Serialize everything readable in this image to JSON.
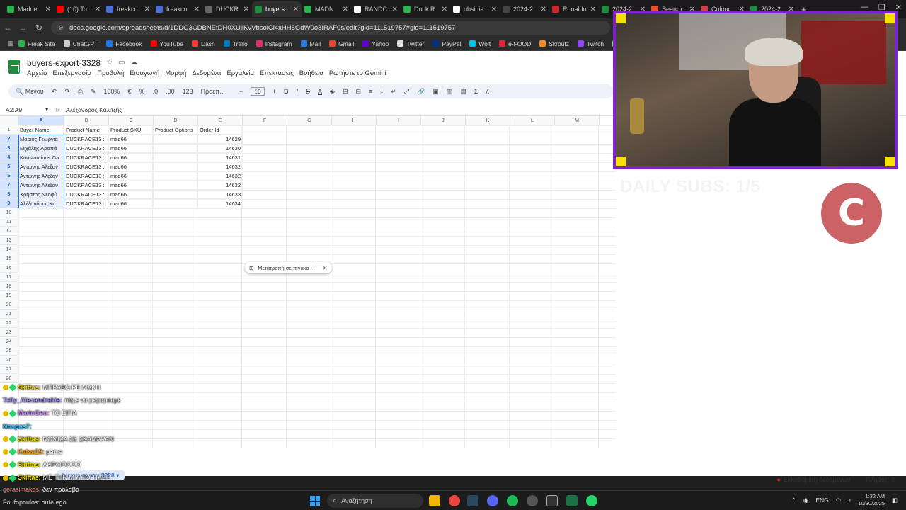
{
  "browser": {
    "tabs": [
      {
        "label": "Madne",
        "color": "#2bb24c"
      },
      {
        "label": "(10) Το",
        "color": "#ff0000"
      },
      {
        "label": "freakco",
        "color": "#4a6fd6"
      },
      {
        "label": "freakco",
        "color": "#4a6fd6"
      },
      {
        "label": "DUCKR",
        "color": "#666666"
      },
      {
        "label": "buyers",
        "color": "#1e8e3e"
      },
      {
        "label": "MADN",
        "color": "#2bb24c"
      },
      {
        "label": "RANDC",
        "color": "#ffffff"
      },
      {
        "label": "Duck R",
        "color": "#2bb24c"
      },
      {
        "label": "obsidia",
        "color": "#ffffff"
      },
      {
        "label": "2024-2",
        "color": "#444444"
      },
      {
        "label": "Ronaldo",
        "color": "#cc2a2a"
      },
      {
        "label": "2024-2",
        "color": "#1e8e3e"
      },
      {
        "label": "Search",
        "color": "#f25022"
      },
      {
        "label": "Colour",
        "color": "#c44"
      },
      {
        "label": "2024-2",
        "color": "#1e8e3e"
      }
    ],
    "url": "docs.google.com/spreadsheets/d/1DDG3CDBNEtDH0XUjlKvVbsolCi4xHH5GdW0o8IRAF0s/edit?gid=111519757#gid=111519757",
    "bookmarks": [
      {
        "label": "Freak Site",
        "color": "#2bb24c"
      },
      {
        "label": "ChatGPT",
        "color": "#cccccc"
      },
      {
        "label": "Facebook",
        "color": "#1877f2"
      },
      {
        "label": "YouTube",
        "color": "#ff0000"
      },
      {
        "label": "Dash",
        "color": "#ff3b30"
      },
      {
        "label": "Trello",
        "color": "#0079bf"
      },
      {
        "label": "Instagram",
        "color": "#e1306c"
      },
      {
        "label": "Mail",
        "color": "#2a7ae2"
      },
      {
        "label": "Gmail",
        "color": "#ea4335"
      },
      {
        "label": "Yahoo",
        "color": "#6001d2"
      },
      {
        "label": "Twitter",
        "color": "#dddddd"
      },
      {
        "label": "PayPal",
        "color": "#003087"
      },
      {
        "label": "Wolt",
        "color": "#00c2e8"
      },
      {
        "label": "e-FOOD",
        "color": "#e32636"
      },
      {
        "label": "Skroutz",
        "color": "#f68b24"
      },
      {
        "label": "Twitch",
        "color": "#9146ff"
      },
      {
        "label": "Kick",
        "color": "#53fc18"
      }
    ]
  },
  "sheet": {
    "title": "buyers-export-3328",
    "menu": [
      "Αρχείο",
      "Επεξεργασία",
      "Προβολή",
      "Εισαγωγή",
      "Μορφή",
      "Δεδομένα",
      "Εργαλεία",
      "Επεκτάσεις",
      "Βοήθεια",
      "Ρωτήστε το Gemini"
    ],
    "toolbar": {
      "menus": "Μενού",
      "zoom": "100%",
      "currency": "€",
      "percent": "%",
      "dec_less": ".0",
      "dec_more": ".00",
      "number_fmt": "123",
      "font": "Προεπ...",
      "font_size": "10"
    },
    "cell_ref": "A2:A9",
    "formula": "Αλέξανδρος Καλιτζής",
    "columns": [
      "A",
      "B",
      "C",
      "D",
      "E",
      "F",
      "G",
      "H",
      "I",
      "J",
      "K",
      "L",
      "M"
    ],
    "headers": [
      "Buyer Name",
      "Product Name",
      "Product SKU",
      "Product Options",
      "Order Id"
    ],
    "rows": [
      [
        "Μαριος Γεωργιά",
        "DUCKRACE13 :",
        "mad66",
        "",
        "14629"
      ],
      [
        "Μιχάλης Αραπά",
        "DUCKRACE13 :",
        "mad66",
        "",
        "14630"
      ],
      [
        "Konstantinos Ga",
        "DUCKRACE13 :",
        "mad66",
        "",
        "14631"
      ],
      [
        "Αντωνης Αλεξαν",
        "DUCKRACE13 :",
        "mad66",
        "",
        "14632"
      ],
      [
        "Αντωνης Αλεξαν",
        "DUCKRACE13 :",
        "mad66",
        "",
        "14632"
      ],
      [
        "Αντωνης Αλεξαν",
        "DUCKRACE13 :",
        "mad66",
        "",
        "14632"
      ],
      [
        "Χρήστος Νεοφύ",
        "DUCKRACE13 :",
        "mad66",
        "",
        "14633"
      ],
      [
        "Αλέξανδρος Κα",
        "DUCKRACE13 :",
        "mad66",
        "",
        "14634"
      ]
    ],
    "row_numbers": [
      "1",
      "2",
      "3",
      "4",
      "5",
      "6",
      "7",
      "8",
      "9",
      "10",
      "11",
      "12",
      "13",
      "14",
      "15",
      "16",
      "17",
      "18",
      "19",
      "20",
      "21",
      "22",
      "23",
      "24",
      "25",
      "26",
      "27",
      "28"
    ],
    "convert_chip": "Μετατροπή σε πίνακα",
    "sheet_tab": "buyers-export-3328",
    "status_warning": "Εκκαθάριση δεδομένων",
    "status_count": "Πλήθος: 8"
  },
  "overlay": {
    "daily_subs": "DAILY SUBS: 1/5",
    "logo_letter": "C",
    "webcam_color": "#7e22ce",
    "chat": [
      {
        "user": "Skiftas:",
        "msg": "ΜΠΡΑΒΟ ΡΕ ΜΑΚΗ",
        "color": "#f5e000",
        "badge": true
      },
      {
        "user": "Tεlly_Alexandrakis:",
        "msg": "πάμε να ρεφαρουμε",
        "color": "#a78bfa",
        "badge": false
      },
      {
        "user": "MarioGeo:",
        "msg": "ΤΟ ΕΙΠΑ",
        "color": "#c084fc",
        "badge": true
      },
      {
        "user": "Nosρas7:",
        "msg": "",
        "color": "#38bdf8",
        "badge": false
      },
      {
        "user": "Skiftas:",
        "msg": "ΝΟΜΙΖΑ ΣΕ ΣΚΑΜΑΡΑΝ",
        "color": "#f5e000",
        "badge": true
      },
      {
        "user": "Katsa19:",
        "msg": "pame",
        "color": "#f59e0b",
        "badge": true
      },
      {
        "user": "Skiftas:",
        "msg": "ΑΚΡΑΙΟΟΟΟ",
        "color": "#f5e000",
        "badge": true
      },
      {
        "user": "Skiftas:",
        "msg": "ΜΕ ΤΗΝ ΜΙΑ ΤΟ ΤΙΑΞΕ",
        "color": "#f5e000",
        "badge": true
      }
    ],
    "chat_bottom1_user": "gerasimakos:",
    "chat_bottom1_msg": "δεν πρόλαβα",
    "chat_bottom2_user": "Foufopoulos:",
    "chat_bottom2_msg": "oute ego"
  },
  "taskbar": {
    "search_placeholder": "Αναζήτηση",
    "lang": "ENG",
    "time": "1:32 AM",
    "date": "10/30/2025"
  }
}
